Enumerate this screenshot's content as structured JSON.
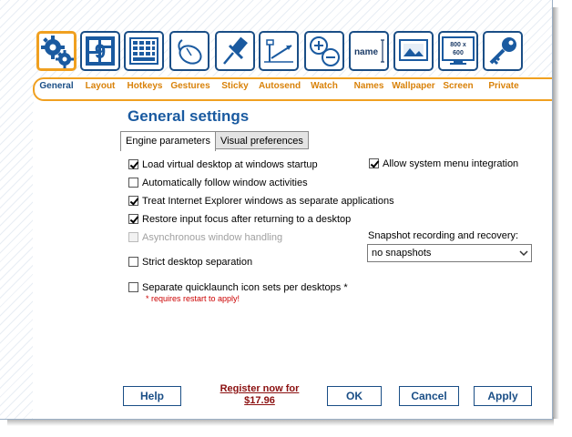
{
  "nav": {
    "items": [
      {
        "label": "General",
        "icon": "gears-icon",
        "active": true
      },
      {
        "label": "Layout",
        "icon": "layout-grid-icon",
        "active": false
      },
      {
        "label": "Hotkeys",
        "icon": "keyboard-icon",
        "active": false
      },
      {
        "label": "Gestures",
        "icon": "mouse-icon",
        "active": false
      },
      {
        "label": "Sticky",
        "icon": "pushpin-icon",
        "active": false
      },
      {
        "label": "Autosend",
        "icon": "autosend-arrow-icon",
        "active": false
      },
      {
        "label": "Watch",
        "icon": "plus-minus-icon",
        "active": false
      },
      {
        "label": "Names",
        "icon": "name-tag-icon",
        "active": false
      },
      {
        "label": "Wallpaper",
        "icon": "wallpaper-picture-icon",
        "active": false
      },
      {
        "label": "Screen",
        "icon": "monitor-resolution-icon",
        "active": false
      },
      {
        "label": "Private",
        "icon": "key-icon",
        "active": false
      }
    ],
    "names_icon_text": "name",
    "screen_icon_text_1": "800 x",
    "screen_icon_text_2": "600"
  },
  "page": {
    "title": "General settings",
    "tabs": [
      {
        "label": "Engine parameters",
        "active": true
      },
      {
        "label": "Visual preferences",
        "active": false
      }
    ]
  },
  "options": {
    "load_at_startup": {
      "label": "Load virtual desktop at windows startup",
      "checked": true
    },
    "follow_window": {
      "label": "Automatically follow window activities",
      "checked": false
    },
    "ie_separate": {
      "label": "Treat Internet Explorer windows as separate applications",
      "checked": true
    },
    "restore_focus": {
      "label": "Restore input focus after returning to a desktop",
      "checked": true
    },
    "async_handling": {
      "label": "Asynchronous window handling",
      "checked": false,
      "disabled": true
    },
    "strict_separation": {
      "label": "Strict desktop separation",
      "checked": false
    },
    "quicklaunch": {
      "label": "Separate quicklaunch icon sets per desktops *",
      "checked": false
    },
    "system_menu": {
      "label": "Allow system menu integration",
      "checked": true
    }
  },
  "restart_note": "* requires restart to apply!",
  "snapshot": {
    "label": "Snapshot recording and recovery:",
    "value": "no snapshots"
  },
  "footer": {
    "help": "Help",
    "register_line1": "Register now for",
    "register_line2": "$17.96",
    "ok": "OK",
    "cancel": "Cancel",
    "apply": "Apply"
  },
  "colors": {
    "accent_orange": "#f0a020",
    "brand_blue": "#1a4e86",
    "title_blue": "#1a5aa0",
    "note_red": "#cc0000",
    "register_red": "#8b1010"
  }
}
